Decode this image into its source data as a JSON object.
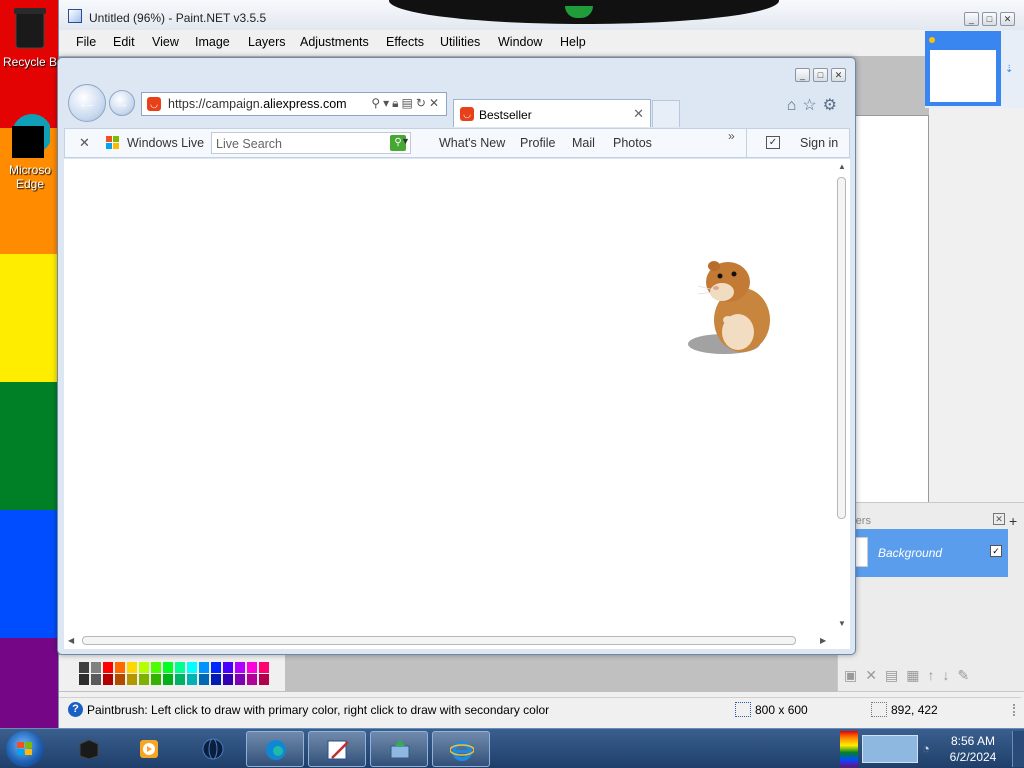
{
  "desktop": {
    "icons": [
      {
        "label": "Recycle B",
        "icon": "recycle-bin-icon"
      },
      {
        "label": "Microso Edge",
        "icon": "edge-icon"
      }
    ],
    "stripe_colors": [
      "#e40303",
      "#ff8c00",
      "#ffed00",
      "#008026",
      "#004dff",
      "#750787"
    ]
  },
  "paintnet": {
    "title": "Untitled (96%) - Paint.NET v3.5.5",
    "menu": [
      "File",
      "Edit",
      "View",
      "Image",
      "Layers",
      "Adjustments",
      "Effects",
      "Utilities",
      "Window",
      "Help"
    ],
    "layers_panel": {
      "title": "rers",
      "layer_name": "Background",
      "visible": true
    },
    "status": {
      "hint": "Paintbrush: Left click to draw with primary color, right click to draw with secondary color",
      "image_size": "800 x 600",
      "cursor": "892, 422"
    },
    "palette_colors": [
      "#404040",
      "#808080",
      "#ff0000",
      "#ff6a00",
      "#ffd800",
      "#b6ff00",
      "#4cff00",
      "#00ff21",
      "#00ff90",
      "#00ffff",
      "#0094ff",
      "#0026ff",
      "#4800ff",
      "#b200ff",
      "#ff00dc",
      "#ff006e"
    ]
  },
  "browser": {
    "url_prefix": "https://campaign.",
    "url_domain": "aliexpress.com",
    "tab_title": "Bestseller",
    "commandbar": {
      "windows_live": "Windows Live",
      "search_placeholder": "Live Search",
      "links": [
        "What's New",
        "Profile",
        "Mail",
        "Photos"
      ],
      "sign_in": "Sign in"
    }
  },
  "taskbar": {
    "time": "8:56 AM",
    "date": "6/2/2024"
  }
}
